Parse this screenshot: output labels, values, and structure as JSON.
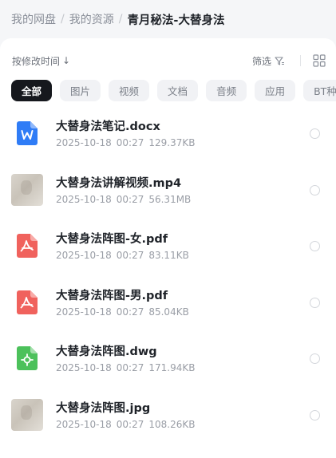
{
  "breadcrumb": {
    "items": [
      "我的网盘",
      "我的资源"
    ],
    "current": "青月秘法-大替身法"
  },
  "toolbar": {
    "sort_label": "按修改时间",
    "sort_arrow": "↓",
    "filter_label": "筛选"
  },
  "chips": [
    "全部",
    "图片",
    "视频",
    "文档",
    "音频",
    "应用",
    "BT种子"
  ],
  "active_chip": "全部",
  "files": [
    {
      "name": "大替身法笔记.docx",
      "date": "2025-10-18",
      "time": "00:27",
      "size": "129.37KB",
      "icon": "word-file-icon"
    },
    {
      "name": "大替身法讲解视频.mp4",
      "date": "2025-10-18",
      "time": "00:27",
      "size": "56.31MB",
      "icon": "video-thumbnail"
    },
    {
      "name": "大替身法阵图-女.pdf",
      "date": "2025-10-18",
      "time": "00:27",
      "size": "83.11KB",
      "icon": "pdf-file-icon"
    },
    {
      "name": "大替身法阵图-男.pdf",
      "date": "2025-10-18",
      "time": "00:27",
      "size": "85.04KB",
      "icon": "pdf-file-icon"
    },
    {
      "name": "大替身法阵图.dwg",
      "date": "2025-10-18",
      "time": "00:27",
      "size": "171.94KB",
      "icon": "cad-file-icon"
    },
    {
      "name": "大替身法阵图.jpg",
      "date": "2025-10-18",
      "time": "00:27",
      "size": "108.26KB",
      "icon": "image-thumbnail"
    }
  ],
  "colors": {
    "word": "#2f7cf6",
    "pdf": "#f0625d",
    "cad": "#4cc15b",
    "active_chip": "#16181d"
  }
}
